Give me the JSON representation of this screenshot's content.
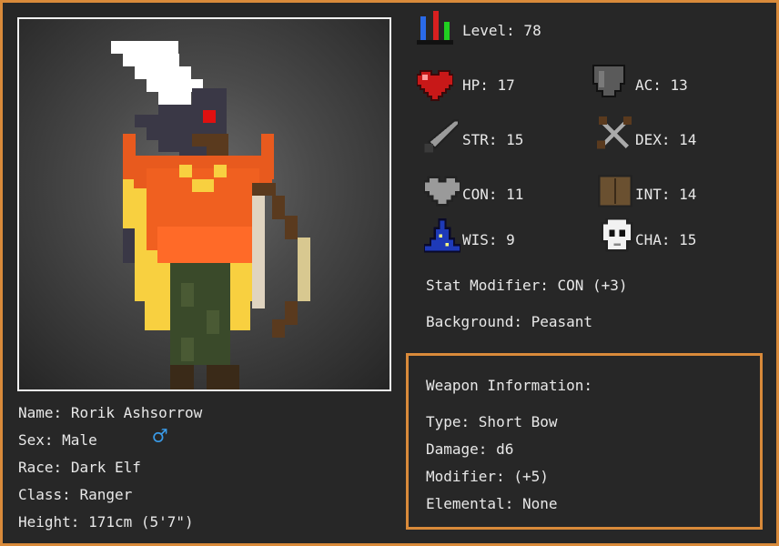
{
  "character": {
    "name_label": "Name:",
    "name": "Rorik Ashsorrow",
    "sex_label": "Sex:",
    "sex": "Male",
    "race_label": "Race:",
    "race": "Dark Elf",
    "class_label": "Class:",
    "class": "Ranger",
    "height_label": "Height:",
    "height": "171cm (5'7\")"
  },
  "stats": {
    "level": "Level: 78",
    "hp": "HP: 17",
    "ac": "AC: 13",
    "str": "STR: 15",
    "dex": "DEX: 14",
    "con": "CON: 11",
    "int": "INT: 14",
    "wis": "WIS: 9",
    "cha": "CHA: 15",
    "modifier": "Stat Modifier: CON (+3)",
    "background": "Background: Peasant"
  },
  "weapon": {
    "header": "Weapon Information:",
    "type": "Type: Short Bow",
    "damage": "Damage: d6",
    "modifier": "Modifier: (+5)",
    "elemental": "Elemental: None"
  },
  "icons": {
    "level": "level-bars-icon",
    "hp": "heart-icon",
    "ac": "shield-icon",
    "str": "sword-icon",
    "dex": "crossed-daggers-icon",
    "con": "gray-heart-icon",
    "int": "book-icon",
    "wis": "wizard-hat-icon",
    "cha": "skull-icon",
    "sex": "male-symbol-icon"
  },
  "colors": {
    "frame_border": "#d98a3a",
    "male_symbol": "#3a9be8"
  }
}
